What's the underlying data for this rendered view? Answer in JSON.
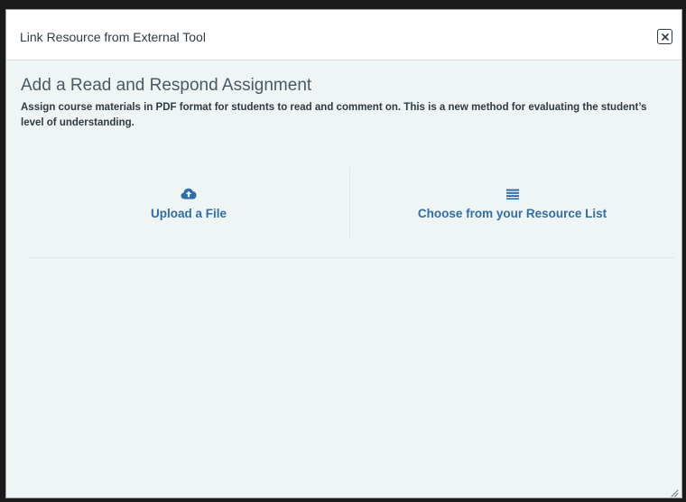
{
  "dialog": {
    "title": "Link Resource from External Tool",
    "close_icon": "close-icon"
  },
  "content": {
    "heading": "Add a Read and Respond Assignment",
    "description": "Assign course materials in PDF format for students to read and comment on. This is a new method for evaluating the student’s level of understanding."
  },
  "options": [
    {
      "label": "Upload a File",
      "icon": "cloud-upload-icon"
    },
    {
      "label": "Choose from your Resource List",
      "icon": "list-icon"
    }
  ],
  "colors": {
    "link": "#2f6ea8",
    "body_background": "#eff4f5",
    "text": "#2d3b45"
  }
}
